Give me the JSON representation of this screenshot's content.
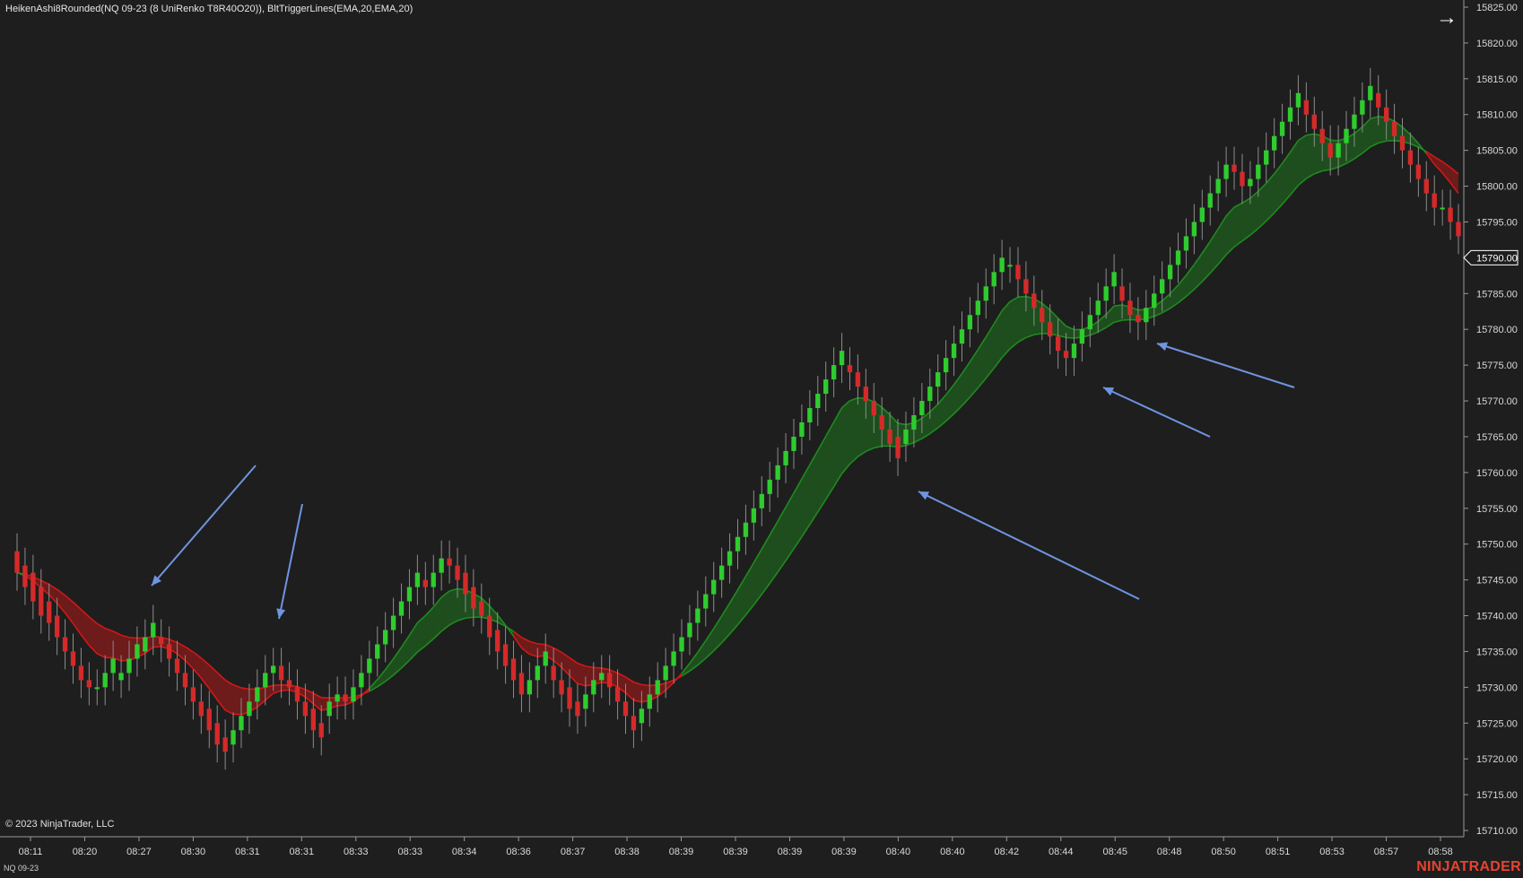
{
  "header": {
    "title": "HeikenAshi8Rounded(NQ 09-23 (8 UniRenko T8R40O20)), BltTriggerLines(EMA,20,EMA,20)"
  },
  "toolbar": {
    "arrow_icon": "arrow-right-icon",
    "arrow_glyph": "→"
  },
  "footer": {
    "copyright": "© 2023 NinjaTrader, LLC",
    "instrument": "NQ 09-23",
    "brand": "NINJATRADER"
  },
  "colors": {
    "background": "#1e1e1e",
    "up_candle": "#2ecc2e",
    "down_candle": "#d42a2a",
    "bull_band": "#1f8a1f",
    "bear_band": "#d01818",
    "annotation_arrow": "#6f94e0",
    "price_flag_border": "#ffffff"
  },
  "chart_data": {
    "type": "candlestick",
    "y_axis": {
      "min": 15710,
      "max": 15825,
      "ticks": [
        "15825.00",
        "15820.00",
        "15815.00",
        "15810.00",
        "15805.00",
        "15800.00",
        "15795.00",
        "15790.00",
        "15785.00",
        "15780.00",
        "15775.00",
        "15770.00",
        "15765.00",
        "15760.00",
        "15755.00",
        "15750.00",
        "15745.00",
        "15740.00",
        "15735.00",
        "15730.00",
        "15725.00",
        "15720.00",
        "15715.00",
        "15710.00"
      ],
      "last_price": "15790.00"
    },
    "x_axis": {
      "ticks": [
        "08:11",
        "08:20",
        "08:27",
        "08:30",
        "08:31",
        "08:31",
        "08:33",
        "08:33",
        "08:34",
        "08:36",
        "08:37",
        "08:38",
        "08:39",
        "08:39",
        "08:39",
        "08:39",
        "08:40",
        "08:40",
        "08:42",
        "08:44",
        "08:45",
        "08:48",
        "08:50",
        "08:51",
        "08:53",
        "08:57",
        "08:58"
      ]
    },
    "grid": false,
    "series": [
      {
        "name": "HeikenAshi8Rounded",
        "kind": "candles"
      },
      {
        "name": "BltTriggerLines",
        "kind": "band"
      }
    ],
    "candles": [
      {
        "o": 15749,
        "c": 15746
      },
      {
        "o": 15747,
        "c": 15744
      },
      {
        "o": 15746,
        "c": 15742
      },
      {
        "o": 15744,
        "c": 15740
      },
      {
        "o": 15742,
        "c": 15739
      },
      {
        "o": 15740,
        "c": 15737
      },
      {
        "o": 15737,
        "c": 15735
      },
      {
        "o": 15735,
        "c": 15733
      },
      {
        "o": 15733,
        "c": 15731
      },
      {
        "o": 15731,
        "c": 15730
      },
      {
        "o": 15730,
        "c": 15730
      },
      {
        "o": 15730,
        "c": 15732
      },
      {
        "o": 15732,
        "c": 15734
      },
      {
        "o": 15731,
        "c": 15732
      },
      {
        "o": 15732,
        "c": 15734
      },
      {
        "o": 15734,
        "c": 15736
      },
      {
        "o": 15735,
        "c": 15737
      },
      {
        "o": 15737,
        "c": 15739
      },
      {
        "o": 15737,
        "c": 15736
      },
      {
        "o": 15736,
        "c": 15734
      },
      {
        "o": 15734,
        "c": 15732
      },
      {
        "o": 15732,
        "c": 15730
      },
      {
        "o": 15730,
        "c": 15728
      },
      {
        "o": 15728,
        "c": 15726
      },
      {
        "o": 15727,
        "c": 15724
      },
      {
        "o": 15725,
        "c": 15722
      },
      {
        "o": 15723,
        "c": 15721
      },
      {
        "o": 15722,
        "c": 15724
      },
      {
        "o": 15724,
        "c": 15726
      },
      {
        "o": 15726,
        "c": 15728
      },
      {
        "o": 15728,
        "c": 15730
      },
      {
        "o": 15730,
        "c": 15732
      },
      {
        "o": 15732,
        "c": 15733
      },
      {
        "o": 15733,
        "c": 15731
      },
      {
        "o": 15731,
        "c": 15730
      },
      {
        "o": 15730,
        "c": 15728
      },
      {
        "o": 15728,
        "c": 15726
      },
      {
        "o": 15727,
        "c": 15724
      },
      {
        "o": 15725,
        "c": 15723
      },
      {
        "o": 15726,
        "c": 15728
      },
      {
        "o": 15728,
        "c": 15729
      },
      {
        "o": 15729,
        "c": 15728
      },
      {
        "o": 15728,
        "c": 15730
      },
      {
        "o": 15730,
        "c": 15732
      },
      {
        "o": 15732,
        "c": 15734
      },
      {
        "o": 15734,
        "c": 15736
      },
      {
        "o": 15736,
        "c": 15738
      },
      {
        "o": 15738,
        "c": 15740
      },
      {
        "o": 15740,
        "c": 15742
      },
      {
        "o": 15742,
        "c": 15744
      },
      {
        "o": 15744,
        "c": 15746
      },
      {
        "o": 15745,
        "c": 15744
      },
      {
        "o": 15744,
        "c": 15746
      },
      {
        "o": 15746,
        "c": 15748
      },
      {
        "o": 15748,
        "c": 15747
      },
      {
        "o": 15747,
        "c": 15745
      },
      {
        "o": 15746,
        "c": 15743
      },
      {
        "o": 15744,
        "c": 15741
      },
      {
        "o": 15742,
        "c": 15740
      },
      {
        "o": 15740,
        "c": 15737
      },
      {
        "o": 15738,
        "c": 15735
      },
      {
        "o": 15736,
        "c": 15733
      },
      {
        "o": 15734,
        "c": 15731
      },
      {
        "o": 15732,
        "c": 15729
      },
      {
        "o": 15729,
        "c": 15731
      },
      {
        "o": 15731,
        "c": 15733
      },
      {
        "o": 15733,
        "c": 15735
      },
      {
        "o": 15733,
        "c": 15731
      },
      {
        "o": 15731,
        "c": 15729
      },
      {
        "o": 15730,
        "c": 15727
      },
      {
        "o": 15728,
        "c": 15726
      },
      {
        "o": 15727,
        "c": 15729
      },
      {
        "o": 15729,
        "c": 15731
      },
      {
        "o": 15731,
        "c": 15732
      },
      {
        "o": 15732,
        "c": 15730
      },
      {
        "o": 15730,
        "c": 15728
      },
      {
        "o": 15728,
        "c": 15726
      },
      {
        "o": 15726,
        "c": 15724
      },
      {
        "o": 15725,
        "c": 15727
      },
      {
        "o": 15727,
        "c": 15729
      },
      {
        "o": 15729,
        "c": 15731
      },
      {
        "o": 15731,
        "c": 15733
      },
      {
        "o": 15733,
        "c": 15735
      },
      {
        "o": 15735,
        "c": 15737
      },
      {
        "o": 15737,
        "c": 15739
      },
      {
        "o": 15739,
        "c": 15741
      },
      {
        "o": 15741,
        "c": 15743
      },
      {
        "o": 15743,
        "c": 15745
      },
      {
        "o": 15745,
        "c": 15747
      },
      {
        "o": 15747,
        "c": 15749
      },
      {
        "o": 15749,
        "c": 15751
      },
      {
        "o": 15751,
        "c": 15753
      },
      {
        "o": 15753,
        "c": 15755
      },
      {
        "o": 15755,
        "c": 15757
      },
      {
        "o": 15757,
        "c": 15759
      },
      {
        "o": 15759,
        "c": 15761
      },
      {
        "o": 15761,
        "c": 15763
      },
      {
        "o": 15763,
        "c": 15765
      },
      {
        "o": 15765,
        "c": 15767
      },
      {
        "o": 15767,
        "c": 15769
      },
      {
        "o": 15769,
        "c": 15771
      },
      {
        "o": 15771,
        "c": 15773
      },
      {
        "o": 15773,
        "c": 15775
      },
      {
        "o": 15775,
        "c": 15777
      },
      {
        "o": 15775,
        "c": 15774
      },
      {
        "o": 15774,
        "c": 15772
      },
      {
        "o": 15772,
        "c": 15770
      },
      {
        "o": 15770,
        "c": 15768
      },
      {
        "o": 15768,
        "c": 15766
      },
      {
        "o": 15766,
        "c": 15764
      },
      {
        "o": 15765,
        "c": 15762
      },
      {
        "o": 15764,
        "c": 15766
      },
      {
        "o": 15766,
        "c": 15768
      },
      {
        "o": 15768,
        "c": 15770
      },
      {
        "o": 15770,
        "c": 15772
      },
      {
        "o": 15772,
        "c": 15774
      },
      {
        "o": 15774,
        "c": 15776
      },
      {
        "o": 15776,
        "c": 15778
      },
      {
        "o": 15778,
        "c": 15780
      },
      {
        "o": 15780,
        "c": 15782
      },
      {
        "o": 15782,
        "c": 15784
      },
      {
        "o": 15784,
        "c": 15786
      },
      {
        "o": 15786,
        "c": 15788
      },
      {
        "o": 15788,
        "c": 15790
      },
      {
        "o": 15789,
        "c": 15789
      },
      {
        "o": 15789,
        "c": 15787
      },
      {
        "o": 15787,
        "c": 15785
      },
      {
        "o": 15785,
        "c": 15783
      },
      {
        "o": 15783,
        "c": 15781
      },
      {
        "o": 15781,
        "c": 15779
      },
      {
        "o": 15779,
        "c": 15777
      },
      {
        "o": 15777,
        "c": 15776
      },
      {
        "o": 15776,
        "c": 15778
      },
      {
        "o": 15778,
        "c": 15780
      },
      {
        "o": 15780,
        "c": 15782
      },
      {
        "o": 15782,
        "c": 15784
      },
      {
        "o": 15784,
        "c": 15786
      },
      {
        "o": 15786,
        "c": 15788
      },
      {
        "o": 15786,
        "c": 15784
      },
      {
        "o": 15784,
        "c": 15782
      },
      {
        "o": 15782,
        "c": 15781
      },
      {
        "o": 15781,
        "c": 15783
      },
      {
        "o": 15783,
        "c": 15785
      },
      {
        "o": 15785,
        "c": 15787
      },
      {
        "o": 15787,
        "c": 15789
      },
      {
        "o": 15789,
        "c": 15791
      },
      {
        "o": 15791,
        "c": 15793
      },
      {
        "o": 15793,
        "c": 15795
      },
      {
        "o": 15795,
        "c": 15797
      },
      {
        "o": 15797,
        "c": 15799
      },
      {
        "o": 15799,
        "c": 15801
      },
      {
        "o": 15801,
        "c": 15803
      },
      {
        "o": 15803,
        "c": 15802
      },
      {
        "o": 15802,
        "c": 15800
      },
      {
        "o": 15800,
        "c": 15801
      },
      {
        "o": 15801,
        "c": 15803
      },
      {
        "o": 15803,
        "c": 15805
      },
      {
        "o": 15805,
        "c": 15807
      },
      {
        "o": 15807,
        "c": 15809
      },
      {
        "o": 15809,
        "c": 15811
      },
      {
        "o": 15811,
        "c": 15813
      },
      {
        "o": 15812,
        "c": 15810
      },
      {
        "o": 15810,
        "c": 15808
      },
      {
        "o": 15808,
        "c": 15806
      },
      {
        "o": 15806,
        "c": 15804
      },
      {
        "o": 15804,
        "c": 15806
      },
      {
        "o": 15806,
        "c": 15808
      },
      {
        "o": 15808,
        "c": 15810
      },
      {
        "o": 15810,
        "c": 15812
      },
      {
        "o": 15812,
        "c": 15814
      },
      {
        "o": 15813,
        "c": 15811
      },
      {
        "o": 15811,
        "c": 15809
      },
      {
        "o": 15809,
        "c": 15807
      },
      {
        "o": 15807,
        "c": 15805
      },
      {
        "o": 15805,
        "c": 15803
      },
      {
        "o": 15803,
        "c": 15801
      },
      {
        "o": 15801,
        "c": 15799
      },
      {
        "o": 15799,
        "c": 15797
      },
      {
        "o": 15797,
        "c": 15797
      },
      {
        "o": 15797,
        "c": 15795
      },
      {
        "o": 15795,
        "c": 15793
      }
    ],
    "annotations": [
      {
        "type": "arrow",
        "label": "",
        "from_price": 15763,
        "to_price": 15745
      },
      {
        "type": "arrow",
        "label": "",
        "from_price": 15756,
        "to_price": 15740
      },
      {
        "type": "arrow",
        "label": "",
        "from_price": 15743,
        "to_price": 15757
      },
      {
        "type": "arrow",
        "label": "",
        "from_price": 15766,
        "to_price": 15772
      },
      {
        "type": "arrow",
        "label": "",
        "from_price": 15772,
        "to_price": 15777
      }
    ]
  }
}
